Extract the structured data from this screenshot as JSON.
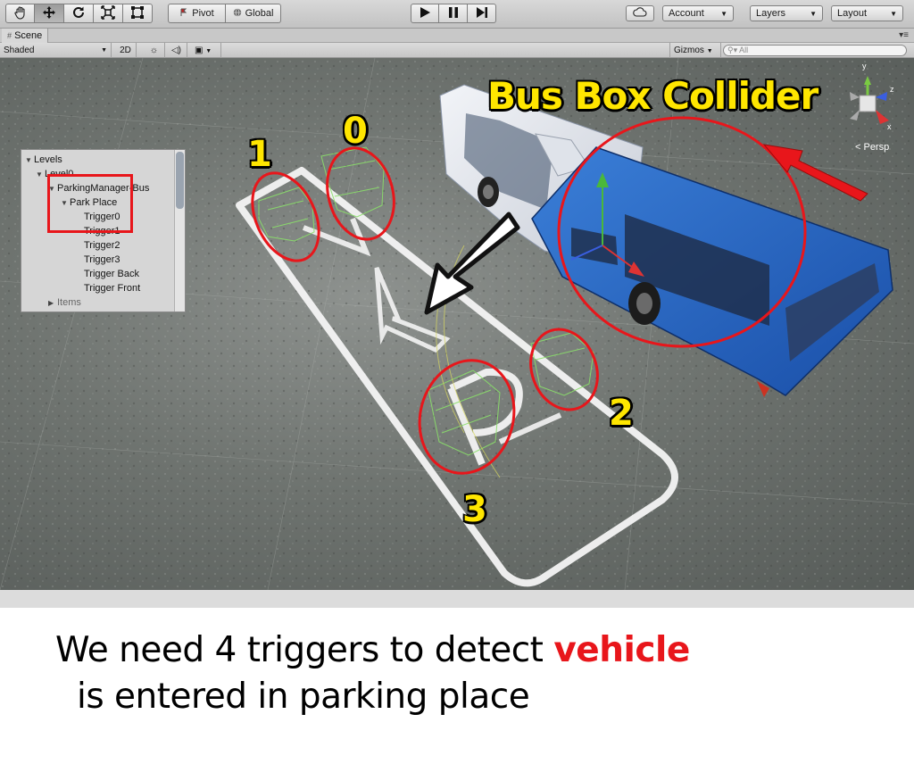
{
  "toolbar": {
    "tools": [
      {
        "name": "hand-tool",
        "icon": "hand-icon"
      },
      {
        "name": "move-tool",
        "icon": "move-arrows-icon"
      },
      {
        "name": "rotate-tool",
        "icon": "rotate-icon"
      },
      {
        "name": "scale-tool",
        "icon": "scale-icon"
      },
      {
        "name": "rect-tool",
        "icon": "rect-tool-icon"
      }
    ],
    "pivot_label": "Pivot",
    "global_label": "Global",
    "play_icon": "play-icon",
    "pause_icon": "pause-icon",
    "step_icon": "step-icon",
    "cloud_icon": "cloud-icon",
    "account_label": "Account",
    "layers_label": "Layers",
    "layout_label": "Layout"
  },
  "scene": {
    "tab_label": "Scene",
    "shading_mode": "Shaded",
    "mode_2d_label": "2D",
    "gizmos_label": "Gizmos",
    "search_placeholder": "All",
    "persp_label": "< Persp",
    "axis_y": "y",
    "axis_z": "z",
    "axis_x": "x"
  },
  "hierarchy": {
    "items": [
      {
        "label": "Levels",
        "depth": 0,
        "expanded": true
      },
      {
        "label": "Level0",
        "depth": 1,
        "expanded": true
      },
      {
        "label": "ParkingManager-Bus",
        "depth": 2,
        "expanded": true
      },
      {
        "label": "Park Place",
        "depth": 3,
        "expanded": true
      },
      {
        "label": "Trigger0",
        "depth": 4
      },
      {
        "label": "Trigger1",
        "depth": 4
      },
      {
        "label": "Trigger2",
        "depth": 4
      },
      {
        "label": "Trigger3",
        "depth": 4
      },
      {
        "label": "Trigger Back",
        "depth": 4
      },
      {
        "label": "Trigger Front",
        "depth": 4
      },
      {
        "label": "Items",
        "depth": 2,
        "expanded": false
      }
    ]
  },
  "annotations": {
    "headline": "Bus Box Collider",
    "trigger_numbers": [
      "0",
      "1",
      "2",
      "3"
    ],
    "highlight_color": "#e8161b",
    "label_color": "#ffe600"
  },
  "caption": {
    "line1_before": "We need 4 triggers to detect ",
    "line1_highlight": "vehicle",
    "line2": "is entered in parking place"
  }
}
